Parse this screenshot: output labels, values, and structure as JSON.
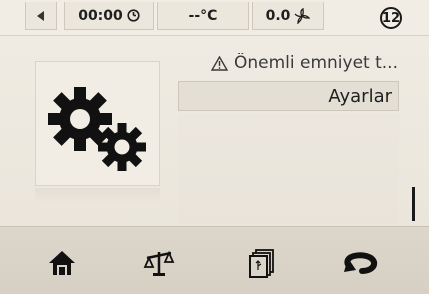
{
  "statusbar": {
    "time": "00:00",
    "temperature": "--°C",
    "fan_value": "0.0",
    "badge_number": "12",
    "icons": {
      "back": "back-arrow-icon",
      "clock": "clock-icon",
      "fan": "fan-icon"
    }
  },
  "main": {
    "warning_text": "Önemli emniyet t...",
    "selected_item": "Ayarlar",
    "icons": {
      "warning": "warning-triangle-icon",
      "settings_tile": "gears-icon"
    }
  },
  "bottom_nav": {
    "items": [
      {
        "name": "home",
        "icon": "home-icon"
      },
      {
        "name": "scale",
        "icon": "scale-icon"
      },
      {
        "name": "recipes",
        "icon": "recipe-book-icon"
      },
      {
        "name": "back",
        "icon": "return-arrow-icon"
      }
    ]
  },
  "colors": {
    "background": "#f3efe6",
    "bottom_bar": "#d9d3c8",
    "text_dark": "#1f1f1f"
  }
}
